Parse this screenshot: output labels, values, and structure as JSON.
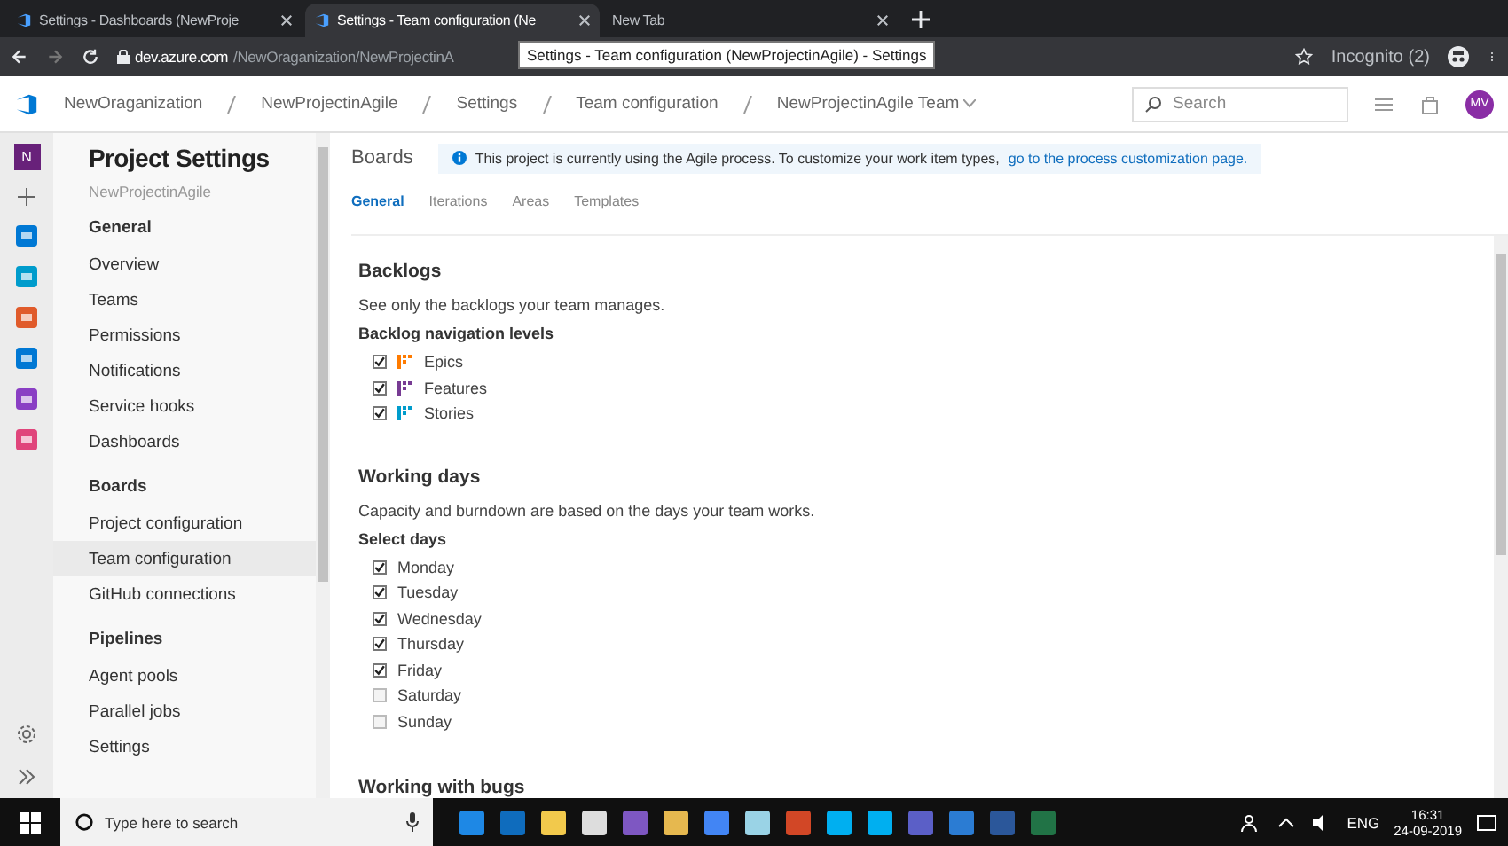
{
  "browser_tabs": [
    {
      "title": "Settings - Dashboards (NewProje",
      "selected": false
    },
    {
      "title": "Settings - Team configuration (Ne",
      "selected": true
    },
    {
      "title": "New Tab",
      "selected": false
    }
  ],
  "address_bar": {
    "url_host": "dev.azure.com",
    "url_path": "/NewOraganization/NewProjectinA",
    "profile": "Incognito (2)"
  },
  "tooltip": "Settings - Team configuration (NewProjectinAgile) - Settings",
  "header": {
    "breadcrumbs": [
      "NewOraganization",
      "NewProjectinAgile",
      "Settings",
      "Team configuration",
      "NewProjectinAgile Team"
    ],
    "search": {
      "placeholder": "Search"
    },
    "avatar": "MV"
  },
  "rail": {
    "project_initial": "N"
  },
  "sidebar": {
    "title": "Project Settings",
    "subtitle": "NewProjectinAgile",
    "sections": [
      {
        "heading": "General",
        "items": [
          {
            "label": "Overview",
            "selected": false
          },
          {
            "label": "Teams",
            "selected": false
          },
          {
            "label": "Permissions",
            "selected": false
          },
          {
            "label": "Notifications",
            "selected": false
          },
          {
            "label": "Service hooks",
            "selected": false
          },
          {
            "label": "Dashboards",
            "selected": false
          }
        ]
      },
      {
        "heading": "Boards",
        "items": [
          {
            "label": "Project configuration",
            "selected": false
          },
          {
            "label": "Team configuration",
            "selected": true
          },
          {
            "label": "GitHub connections",
            "selected": false
          }
        ]
      },
      {
        "heading": "Pipelines",
        "items": [
          {
            "label": "Agent pools",
            "selected": false
          },
          {
            "label": "Parallel jobs",
            "selected": false
          },
          {
            "label": "Settings",
            "selected": false
          }
        ]
      }
    ]
  },
  "content": {
    "title": "Boards",
    "banner": {
      "text": "This project is currently using the Agile process. To customize your work item types, ",
      "link": "go to the process customization page."
    },
    "tabs": [
      {
        "label": "General",
        "selected": true
      },
      {
        "label": "Iterations",
        "selected": false
      },
      {
        "label": "Areas",
        "selected": false
      },
      {
        "label": "Templates",
        "selected": false
      }
    ],
    "backlogs": {
      "heading": "Backlogs",
      "description": "See only the backlogs your team manages.",
      "subheading": "Backlog navigation levels",
      "levels": [
        {
          "label": "Epics",
          "checked": true,
          "color": "#ff7b00"
        },
        {
          "label": "Features",
          "checked": true,
          "color": "#773b93"
        },
        {
          "label": "Stories",
          "checked": true,
          "color": "#009ccc"
        }
      ]
    },
    "working_days": {
      "heading": "Working days",
      "description": "Capacity and burndown are based on the days your team works.",
      "subheading": "Select days",
      "days": [
        {
          "label": "Monday",
          "checked": true
        },
        {
          "label": "Tuesday",
          "checked": true
        },
        {
          "label": "Wednesday",
          "checked": true
        },
        {
          "label": "Thursday",
          "checked": true
        },
        {
          "label": "Friday",
          "checked": true
        },
        {
          "label": "Saturday",
          "checked": false
        },
        {
          "label": "Sunday",
          "checked": false
        }
      ]
    },
    "bugs": {
      "heading": "Working with bugs"
    }
  },
  "taskbar": {
    "search_placeholder": "Type here to search",
    "language": "ENG",
    "time": "16:31",
    "date": "24-09-2019"
  }
}
